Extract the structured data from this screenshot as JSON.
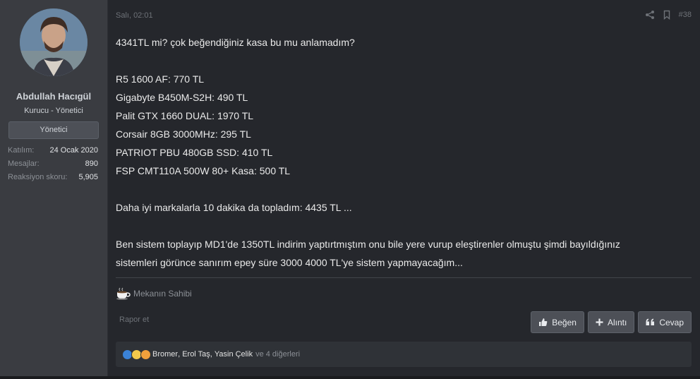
{
  "user": {
    "name": "Abdullah Hacıgül",
    "title": "Kurucu - Yönetici",
    "role_button": "Yönetici",
    "stats": [
      {
        "key": "Katılım:",
        "value": "24 Ocak 2020"
      },
      {
        "key": "Mesajlar:",
        "value": "890"
      },
      {
        "key": "Reaksiyon skoru:",
        "value": "5,905"
      }
    ]
  },
  "post": {
    "date": "Salı, 02:01",
    "number": "#38",
    "lines": [
      "4341TL mi? çok beğendiğiniz kasa bu mu anlamadım?",
      "",
      "R5 1600 AF: 770 TL",
      "Gigabyte B450M-S2H: 490 TL",
      "Palit GTX 1660 DUAL: 1970 TL",
      "Corsair 8GB 3000MHz: 295 TL",
      "PATRIOT PBU 480GB SSD: 410 TL",
      "FSP CMT110A 500W 80+ Kasa: 500 TL",
      "",
      "Daha iyi markalarla 10 dakika da topladım: 4435 TL ...",
      "",
      "Ben sistem toplayıp MD1'de 1350TL indirim yaptırtmıştım onu bile yere vurup eleştirenler olmuştu şimdi bayıldığınız",
      "sistemleri görünce sanırım epey süre 3000 4000 TL'ye sistem yapmayacağım..."
    ],
    "signature": "Mekanın Sahibi",
    "report": "Rapor et"
  },
  "buttons": {
    "like": "Beğen",
    "quote": "Alıntı",
    "reply": "Cevap"
  },
  "reactions": {
    "users": [
      "Bromer",
      "Erol Taş",
      "Yasin Çelik"
    ],
    "more": "ve 4 diğerleri"
  },
  "colors": {
    "background": "#25272c",
    "sidebar": "#3a3c41",
    "button": "#4d5057"
  }
}
